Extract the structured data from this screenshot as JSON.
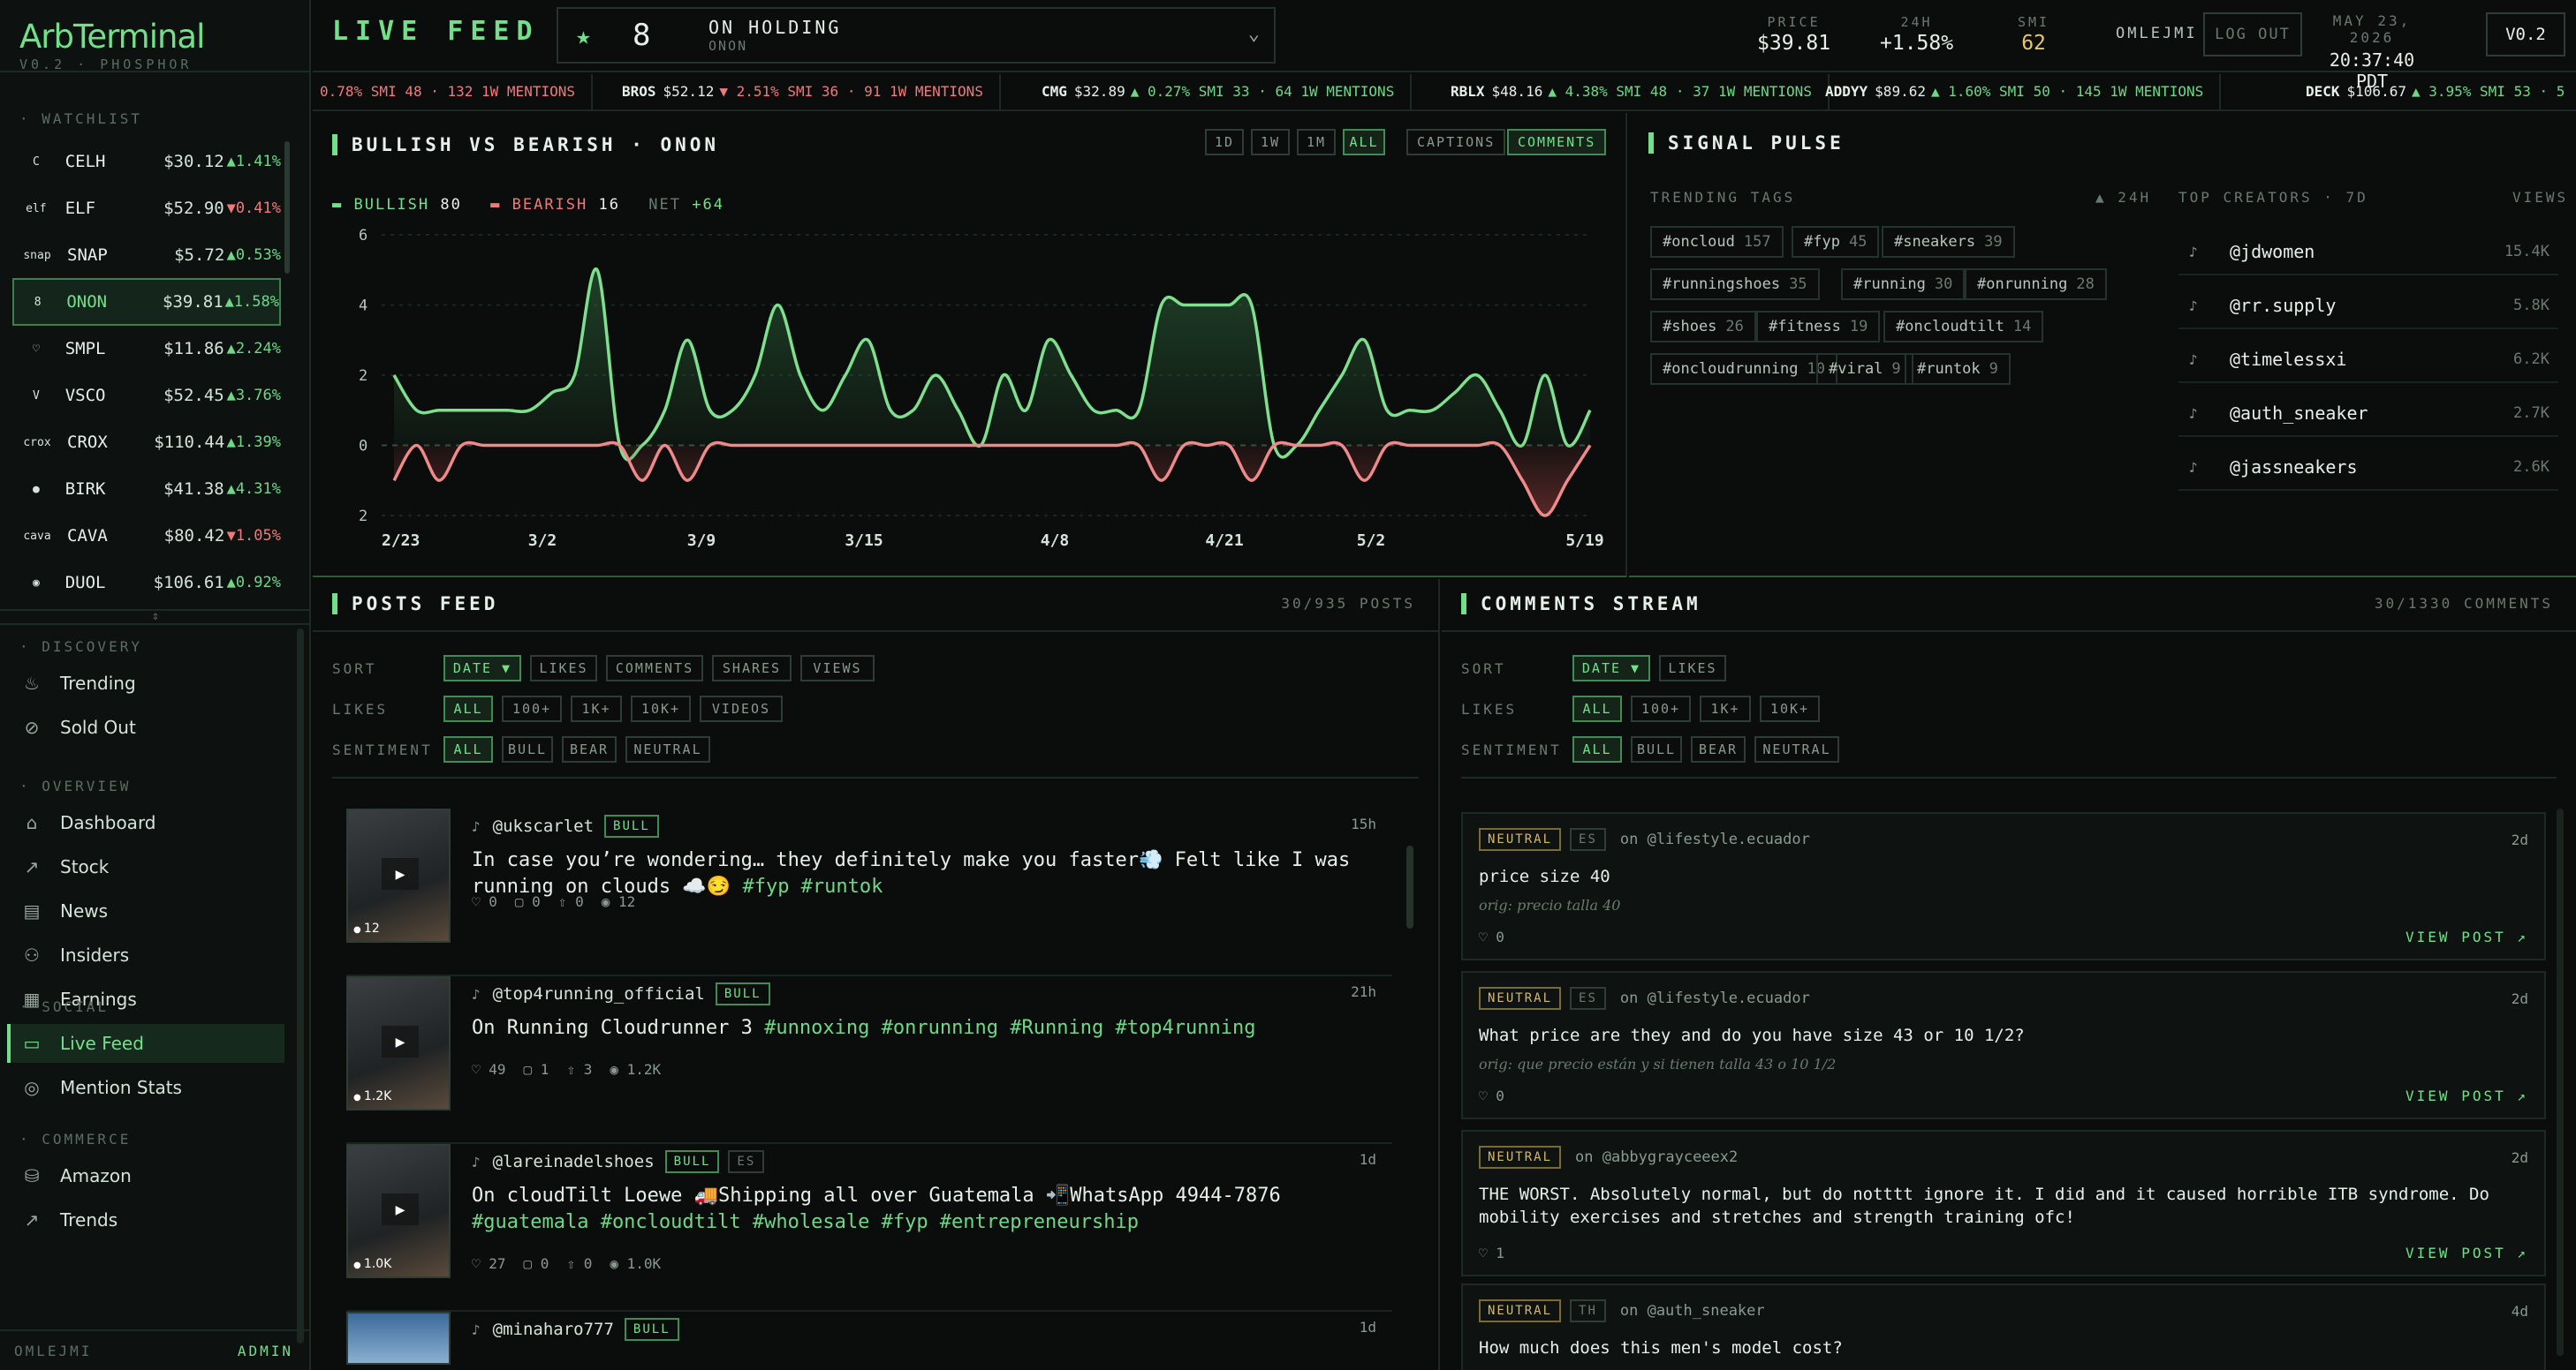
{
  "brand": {
    "name": "ArbTerminal",
    "version": "V0.2 · PHOSPHOR"
  },
  "sidebar": {
    "watchlist_label": "WATCHLIST",
    "watchlist": [
      {
        "icon": "C",
        "ticker": "CELH",
        "price": "$30.12",
        "change": "▲1.41%",
        "dir": "up"
      },
      {
        "icon": "elf",
        "ticker": "ELF",
        "price": "$52.90",
        "change": "▼0.41%",
        "dir": "dn"
      },
      {
        "icon": "snap",
        "ticker": "SNAP",
        "price": "$5.72",
        "change": "▲0.53%",
        "dir": "up"
      },
      {
        "icon": "8",
        "ticker": "ONON",
        "price": "$39.81",
        "change": "▲1.58%",
        "dir": "up"
      },
      {
        "icon": "♡",
        "ticker": "SMPL",
        "price": "$11.86",
        "change": "▲2.24%",
        "dir": "up"
      },
      {
        "icon": "V",
        "ticker": "VSCO",
        "price": "$52.45",
        "change": "▲3.76%",
        "dir": "up"
      },
      {
        "icon": "crox",
        "ticker": "CROX",
        "price": "$110.44",
        "change": "▲1.39%",
        "dir": "up"
      },
      {
        "icon": "●",
        "ticker": "BIRK",
        "price": "$41.38",
        "change": "▲4.31%",
        "dir": "up"
      },
      {
        "icon": "cava",
        "ticker": "CAVA",
        "price": "$80.42",
        "change": "▼1.05%",
        "dir": "dn"
      },
      {
        "icon": "◉",
        "ticker": "DUOL",
        "price": "$106.61",
        "change": "▲0.92%",
        "dir": "up"
      }
    ],
    "sections": [
      {
        "label": "DISCOVERY",
        "items": [
          {
            "icon": "♨",
            "label": "Trending"
          },
          {
            "icon": "⊘",
            "label": "Sold Out"
          }
        ]
      },
      {
        "label": "OVERVIEW",
        "items": [
          {
            "icon": "⌂",
            "label": "Dashboard"
          },
          {
            "icon": "↗",
            "label": "Stock"
          },
          {
            "icon": "▤",
            "label": "News"
          },
          {
            "icon": "⚇",
            "label": "Insiders"
          },
          {
            "icon": "▦",
            "label": "Earnings"
          }
        ]
      },
      {
        "label": "SOCIAL",
        "items": [
          {
            "icon": "▭",
            "label": "Live Feed"
          },
          {
            "icon": "◎",
            "label": "Mention Stats"
          }
        ]
      },
      {
        "label": "COMMERCE",
        "items": [
          {
            "icon": "⛁",
            "label": "Amazon"
          },
          {
            "icon": "↗",
            "label": "Trends"
          }
        ]
      }
    ],
    "footer_user": "OMLEJMI",
    "footer_role": "ADMIN"
  },
  "header": {
    "title": "LIVE FEED",
    "selector": {
      "name": "ON HOLDING",
      "ticker": "ONON"
    },
    "price_label": "PRICE",
    "price": "$39.81",
    "change_label": "24H",
    "change": "+1.58%",
    "smi_label": "SMI",
    "smi": "62",
    "user": "OMLEJMI",
    "logout": "LOG OUT",
    "date": "MAY 23, 2026",
    "time": "20:37:40 PDT",
    "version": "V0.2"
  },
  "ticker": [
    {
      "sym": "",
      "price": "",
      "rest": "0.78% SMI 48 · 132 1W MENTIONS"
    },
    {
      "sym": "BROS",
      "price": "$52.12",
      "rest": "▼ 2.51% SMI 36 · 91 1W MENTIONS"
    },
    {
      "sym": "CMG",
      "price": "$32.89",
      "rest": "▲ 0.27% SMI 33 · 64 1W MENTIONS"
    },
    {
      "sym": "RBLX",
      "price": "$48.16",
      "rest": "▲ 4.38% SMI 48 · 37 1W MENTIONS"
    },
    {
      "sym": "ADDYY",
      "price": "$89.62",
      "rest": "▲ 1.60% SMI 50 · 145 1W MENTIONS"
    },
    {
      "sym": "DECK",
      "price": "$106.67",
      "rest": "▲ 3.95% SMI 53 · 5"
    }
  ],
  "chart_panel": {
    "title": "BULLISH VS BEARISH · ONON",
    "ranges": [
      "1D",
      "1W",
      "1M",
      "ALL"
    ],
    "toggles": [
      "CAPTIONS",
      "COMMENTS"
    ],
    "bull_label": "BULLISH",
    "bull_value": "80",
    "bear_label": "BEARISH",
    "bear_value": "16",
    "net_label": "NET",
    "net_value": "+64"
  },
  "chart_data": {
    "type": "area",
    "title": "BULLISH VS BEARISH · ONON",
    "y_ticks": [
      "6",
      "4",
      "2",
      "0",
      "2"
    ],
    "ylim": [
      -2,
      6
    ],
    "x_ticks": [
      "2/23",
      "3/2",
      "3/9",
      "3/15",
      "4/8",
      "4/21",
      "5/2",
      "5/19"
    ],
    "grid": true,
    "series": [
      {
        "name": "BULLISH",
        "color": "#7ee08f",
        "values": [
          2,
          1,
          1,
          1,
          1,
          1,
          1,
          1.5,
          2,
          5,
          0,
          0,
          1,
          3,
          1,
          1,
          2,
          4,
          2,
          1,
          2,
          3,
          1,
          1,
          2,
          1,
          0,
          2,
          1,
          3,
          2,
          1,
          1,
          1,
          4,
          4,
          4,
          4,
          4,
          0,
          0,
          1,
          2,
          3,
          1,
          1,
          1,
          1.5,
          2,
          1,
          0,
          2,
          0,
          1
        ]
      },
      {
        "name": "BEARISH",
        "color": "#f08a8a",
        "values": [
          -1,
          0,
          -1,
          0,
          0,
          0,
          0,
          0,
          0,
          0,
          0,
          -1,
          0,
          -1,
          0,
          0,
          0,
          0,
          0,
          0,
          0,
          0,
          0,
          0,
          0,
          0,
          0,
          0,
          0,
          0,
          0,
          0,
          0,
          0,
          -1,
          0,
          0,
          0,
          -1,
          0,
          0,
          0,
          0,
          -1,
          0,
          0,
          0,
          0,
          0,
          0,
          -1,
          -2,
          -1,
          0
        ]
      }
    ]
  },
  "signal": {
    "title": "SIGNAL PULSE",
    "tags_label": "TRENDING TAGS",
    "tags_window": "▲ 24H",
    "tags": [
      {
        "t": "#oncloud",
        "n": "157"
      },
      {
        "t": "#fyp",
        "n": "45"
      },
      {
        "t": "#sneakers",
        "n": "39"
      },
      {
        "t": "#runningshoes",
        "n": "35"
      },
      {
        "t": "#running",
        "n": "30"
      },
      {
        "t": "#onrunning",
        "n": "28"
      },
      {
        "t": "#shoes",
        "n": "26"
      },
      {
        "t": "#fitness",
        "n": "19"
      },
      {
        "t": "#oncloudtilt",
        "n": "14"
      },
      {
        "t": "#oncloudrunning",
        "n": "10"
      },
      {
        "t": "#viral",
        "n": "9"
      },
      {
        "t": "#runtok",
        "n": "9"
      }
    ],
    "creators_label": "TOP CREATORS · 7D",
    "views_label": "VIEWS",
    "creators": [
      {
        "h": "@jdwomen",
        "v": "15.4K"
      },
      {
        "h": "@rr.supply",
        "v": "5.8K"
      },
      {
        "h": "@timelessxi",
        "v": "6.2K"
      },
      {
        "h": "@auth_sneaker",
        "v": "2.7K"
      },
      {
        "h": "@jassneakers",
        "v": "2.6K"
      }
    ]
  },
  "posts": {
    "title": "POSTS FEED",
    "count": "30/935 POSTS",
    "sort_label": "SORT",
    "sort": [
      "DATE ▼",
      "LIKES",
      "COMMENTS",
      "SHARES",
      "VIEWS"
    ],
    "likes_label": "LIKES",
    "likes": [
      "ALL",
      "100+",
      "1K+",
      "10K+",
      "VIDEOS"
    ],
    "sent_label": "SENTIMENT",
    "sent": [
      "ALL",
      "BULL",
      "BEAR",
      "NEUTRAL"
    ],
    "items": [
      {
        "user": "@ukscarlet",
        "badge": "BULL",
        "lang": "",
        "time": "15h",
        "text": "In case you’re wondering… they definitely make you faster💨 Felt like I was running on clouds ☁️😏 ",
        "tags": "#fyp #runtok",
        "likes": "♡ 0",
        "cm": "▢ 0",
        "sh": "⇧ 0",
        "views": "◉ 12",
        "thumb": "12"
      },
      {
        "user": "@top4running_official",
        "badge": "BULL",
        "lang": "",
        "time": "21h",
        "text": "On Running Cloudrunner 3 ",
        "tags": "#unnoxing #onrunning #Running #top4running",
        "likes": "♡ 49",
        "cm": "▢ 1",
        "sh": "⇧ 3",
        "views": "◉ 1.2K",
        "thumb": "1.2K"
      },
      {
        "user": "@lareinadelshoes",
        "badge": "BULL",
        "lang": "ES",
        "time": "1d",
        "text": "On cloudTilt Loewe 🚚Shipping all over Guatemala 📲WhatsApp 4944-7876 ",
        "tags": "#guatemala #oncloudtilt #wholesale #fyp #entrepreneurship",
        "likes": "♡ 27",
        "cm": "▢ 0",
        "sh": "⇧ 0",
        "views": "◉ 1.0K",
        "thumb": "1.0K"
      },
      {
        "user": "@minaharo777",
        "badge": "BULL",
        "lang": "",
        "time": "1d",
        "text": "",
        "tags": "",
        "likes": "",
        "cm": "",
        "sh": "",
        "views": "",
        "thumb": ""
      }
    ]
  },
  "comments": {
    "title": "COMMENTS STREAM",
    "count": "30/1330 COMMENTS",
    "sort_label": "SORT",
    "sort": [
      "DATE ▼",
      "LIKES"
    ],
    "likes_label": "LIKES",
    "likes": [
      "ALL",
      "100+",
      "1K+",
      "10K+"
    ],
    "sent_label": "SENTIMENT",
    "sent": [
      "ALL",
      "BULL",
      "BEAR",
      "NEUTRAL"
    ],
    "view_label": "VIEW POST ↗",
    "items": [
      {
        "badge": "NEUTRAL",
        "lang": "ES",
        "on": "on @lifestyle.ecuador",
        "time": "2d",
        "text": "price size 40",
        "orig": "orig: precio talla 40",
        "likes": "♡ 0"
      },
      {
        "badge": "NEUTRAL",
        "lang": "ES",
        "on": "on @lifestyle.ecuador",
        "time": "2d",
        "text": "What price are they and do you have size 43 or 10 1/2?",
        "orig": "orig: que precio están y si tienen talla 43 o 10 1/2",
        "likes": "♡ 0"
      },
      {
        "badge": "NEUTRAL",
        "lang": "",
        "on": "on @abbygrayceeex2",
        "time": "2d",
        "text": "THE WORST. Absolutely normal, but do notttt ignore it. I did and it caused horrible ITB syndrome. Do mobility exercises and stretches and strength training ofc!",
        "orig": "",
        "likes": "♡ 1"
      },
      {
        "badge": "NEUTRAL",
        "lang": "TH",
        "on": "on @auth_sneaker",
        "time": "4d",
        "text": "How much does this men's model cost?",
        "orig": "",
        "likes": ""
      }
    ]
  }
}
